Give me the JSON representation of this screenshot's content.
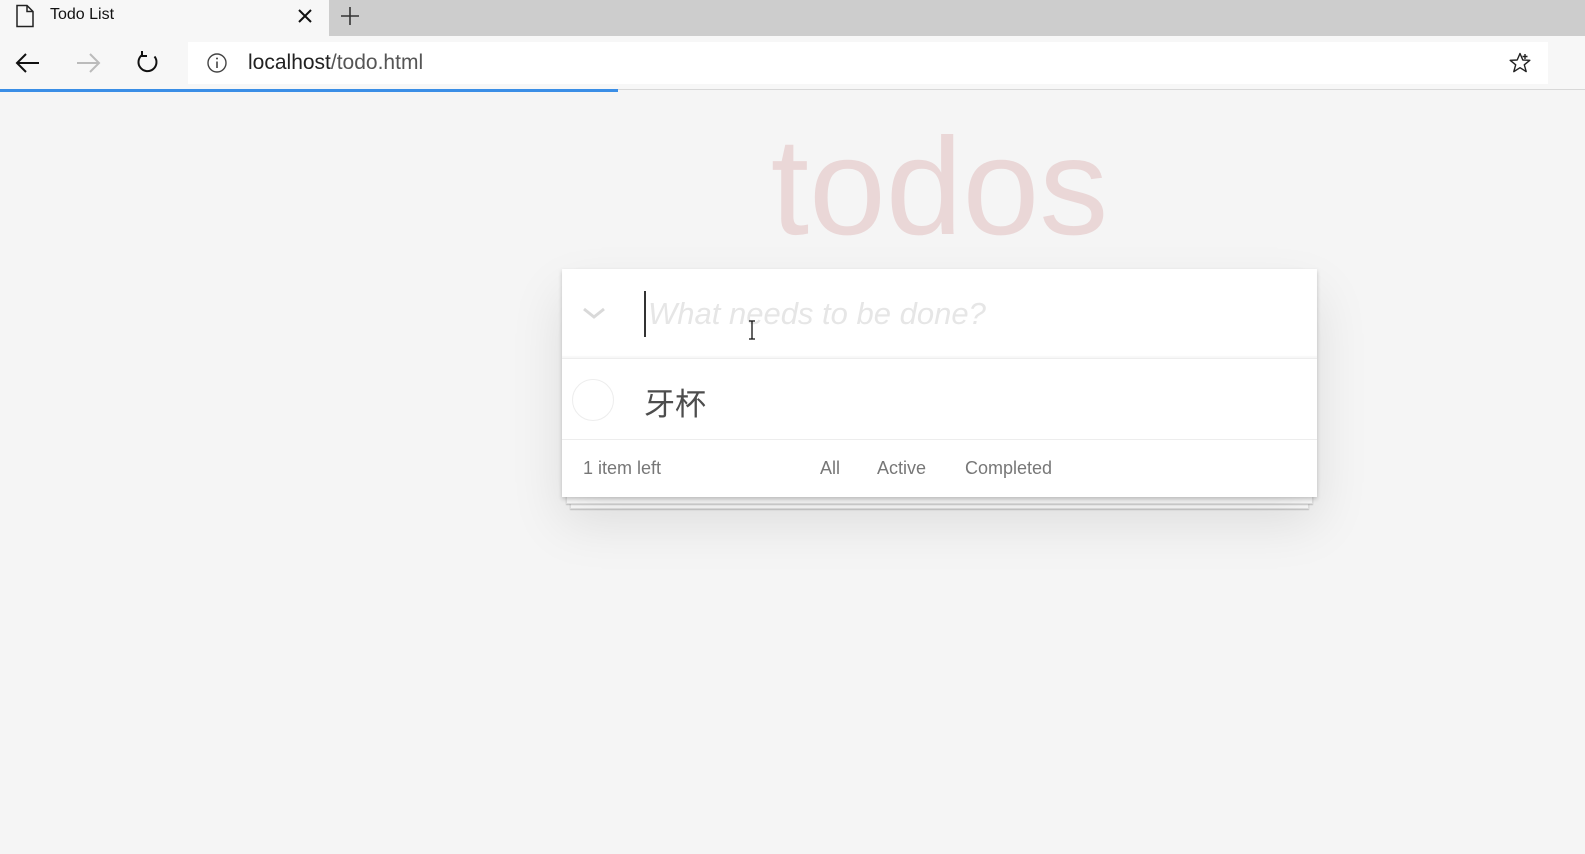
{
  "browser": {
    "tab_title": "Todo List",
    "url_host": "localhost",
    "url_path": "/todo.html",
    "icons": {
      "tab": "page-icon",
      "close": "close-icon",
      "new_tab": "plus-icon",
      "back": "back-arrow-icon",
      "forward": "forward-arrow-icon",
      "refresh": "refresh-icon",
      "info": "info-icon",
      "favorite": "star-icon"
    },
    "load_progress": 0.39,
    "accent_color": "#3a8ee6"
  },
  "app": {
    "title": "todos",
    "title_color": "rgba(175,47,47,0.15)",
    "new_todo": {
      "placeholder": "What needs to be done?",
      "value": ""
    },
    "todos": [
      {
        "label": "牙杯",
        "completed": false
      }
    ],
    "footer": {
      "count_text": "1 item left",
      "filters": [
        "All",
        "Active",
        "Completed"
      ]
    }
  }
}
